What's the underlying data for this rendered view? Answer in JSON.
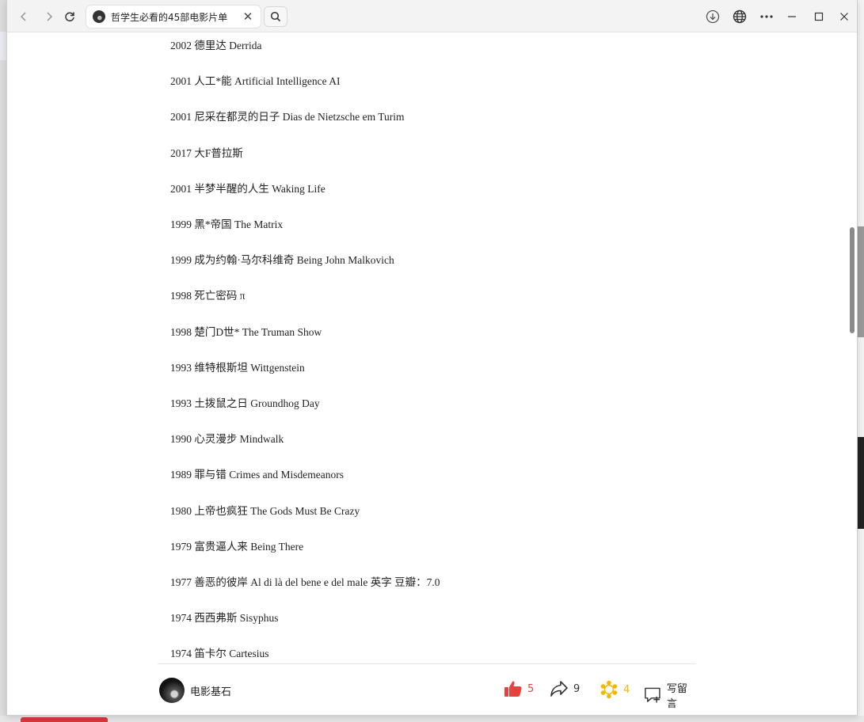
{
  "browser": {
    "tab_title": "哲学生必看的45部电影片单",
    "tab_close": "✕",
    "icons": {
      "back": "back-arrow-icon",
      "forward": "forward-arrow-icon",
      "reload": "reload-icon",
      "search": "search-icon",
      "download": "download-icon",
      "translate": "globe-icon",
      "more": "more-icon",
      "minimize": "minimize-icon",
      "maximize": "maximize-icon",
      "close": "close-icon"
    }
  },
  "films": [
    "2002 德里达 Derrida",
    "2001 人工*能 Artificial Intelligence AI",
    "2001 尼采在都灵的日子 Dias de Nietzsche em Turim",
    "2017 大F普拉斯",
    "2001 半梦半醒的人生 Waking Life",
    "1999 黑*帝国 The Matrix",
    "1999 成为约翰·马尔科维奇 Being John Malkovich",
    "1998 死亡密码 π",
    "1998 楚门D世* The Truman Show",
    "1993 维特根斯坦 Wittgenstein",
    "1993 土拨鼠之日 Groundhog Day",
    "1990 心灵漫步 Mindwalk",
    "1989 罪与错 Crimes and Misdemeanors",
    "1980 上帝也疯狂 The Gods Must Be Crazy",
    "1979 富贵逼人来 Being There",
    "1977 善恶的彼岸 Al di là del bene e del male 英字 豆瓣：7.0",
    "1974 西西弗斯 Sisyphus",
    "1974 笛卡尔 Cartesius"
  ],
  "footer": {
    "author": "电影基石",
    "like_count": "5",
    "share_count": "9",
    "star_count": "4",
    "comment_label": "写留言",
    "colors": {
      "like": "#e8423f",
      "star": "#f5b800",
      "text": "#222222"
    }
  }
}
